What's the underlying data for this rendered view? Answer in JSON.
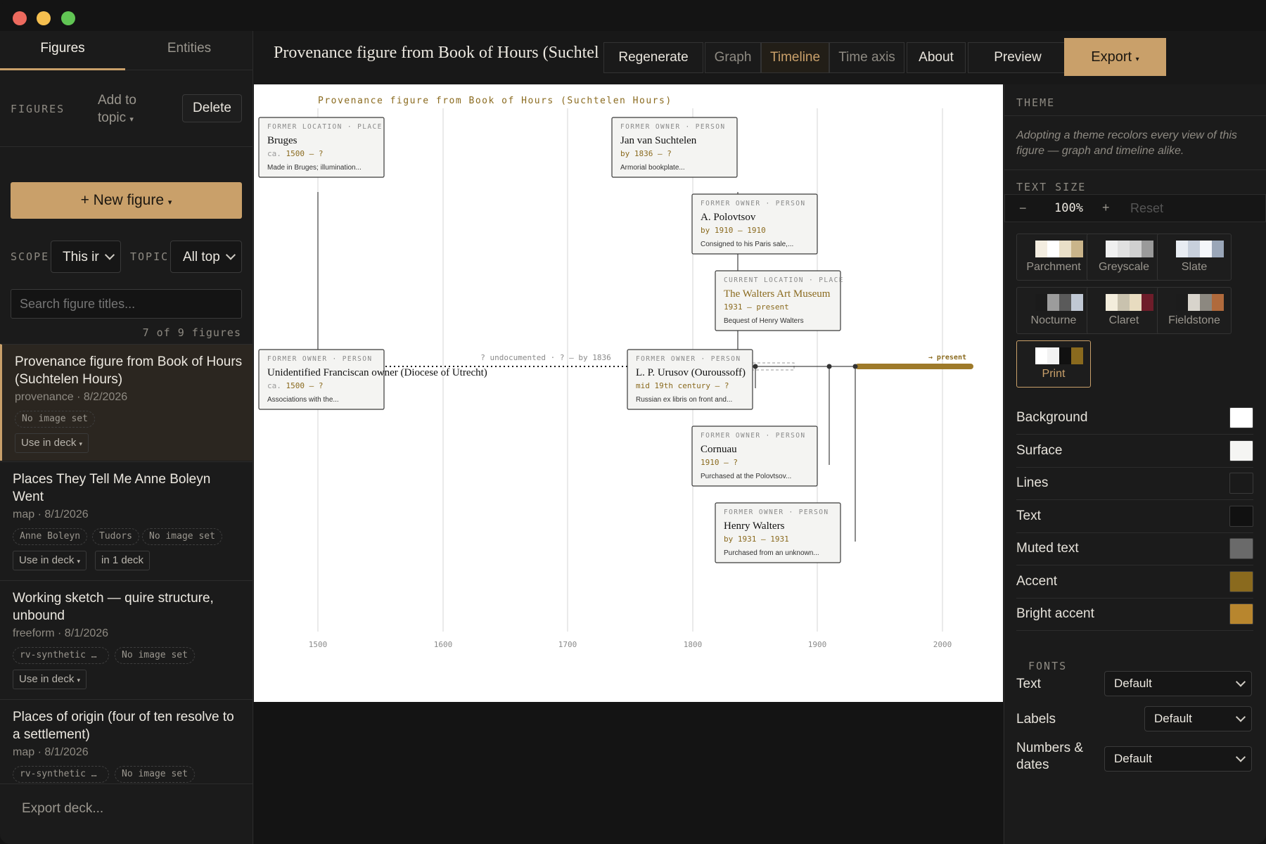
{
  "window": {
    "traffic_colors": [
      "#ed6a5e",
      "#f5bf4f",
      "#61c554"
    ]
  },
  "sidebar": {
    "tabs": [
      "Figures",
      "Entities"
    ],
    "figures_label": "FIGURES",
    "add_to_topic": "Add to topic",
    "delete": "Delete",
    "new_figure": "+ New figure",
    "scope_label": "SCOPE",
    "scope_value": "This ir",
    "topic_label": "TOPIC",
    "topic_value": "All top",
    "search_placeholder": "Search figure titles...",
    "count_text": "7 of 9 figures",
    "items": [
      {
        "title": "Provenance figure from Book of Hours (Suchtelen Hours)",
        "meta": "provenance · 8/2/2026",
        "chips": [
          "No image set"
        ],
        "actions": [
          "Use in deck"
        ]
      },
      {
        "title": "Places They Tell Me Anne Boleyn Went",
        "meta": "map · 8/1/2026",
        "chips": [
          "Anne Boleyn",
          "Tudors",
          "No image set"
        ],
        "actions": [
          "Use in deck",
          "in 1 deck"
        ]
      },
      {
        "title": "Working sketch — quire structure, unbound",
        "meta": "freeform · 8/1/2026",
        "chips": [
          "rv-synthetic …",
          "No image set"
        ],
        "actions": [
          "Use in deck"
        ]
      },
      {
        "title": "Places of origin (four of ten resolve to a settlement)",
        "meta": "map · 8/1/2026",
        "chips": [
          "rv-synthetic …",
          "No image set"
        ],
        "actions": []
      }
    ],
    "export_deck": "Export deck..."
  },
  "toolbar": {
    "title": "Provenance figure from Book of Hours (Suchtel",
    "regenerate": "Regenerate",
    "views": [
      "Graph",
      "Timeline",
      "Time axis"
    ],
    "active_view": "Timeline",
    "about": "About",
    "preview": "Preview",
    "export": "Export"
  },
  "timeline": {
    "title": "Provenance figure from Book of Hours (Suchtelen Hours)",
    "axis_ticks": [
      "1500",
      "1600",
      "1700",
      "1800",
      "1900",
      "2000"
    ],
    "gap_label": "? undocumented · ? — by 1836",
    "present_label": "→ present",
    "cards": [
      {
        "kind": "FORMER LOCATION · PLACE",
        "name": "Bruges",
        "date_prefix": "ca.",
        "date": "1500 – ?",
        "note": "Made in Bruges; illumination..."
      },
      {
        "kind": "FORMER OWNER · PERSON",
        "name": "Jan van Suchtelen",
        "date_prefix": "",
        "date": "by 1836 – ?",
        "note": "Armorial bookplate..."
      },
      {
        "kind": "FORMER OWNER · PERSON",
        "name": "A. Polovtsov",
        "date_prefix": "",
        "date": "by 1910 – 1910",
        "note": "Consigned to his Paris sale,..."
      },
      {
        "kind": "CURRENT LOCATION · PLACE",
        "name": "The Walters Art Museum",
        "date_prefix": "",
        "date": "1931 – present",
        "note": "Bequest of Henry Walters"
      },
      {
        "kind": "FORMER OWNER · PERSON",
        "name": "Unidentified Franciscan owner (Diocese of Utrecht)",
        "date_prefix": "ca.",
        "date": "1500 – ?",
        "note": "Associations with the..."
      },
      {
        "kind": "FORMER OWNER · PERSON",
        "name": "L. P. Urusov (Ouroussoff)",
        "date_prefix": "",
        "date": "mid 19th century – ?",
        "note": "Russian ex libris on front and..."
      },
      {
        "kind": "FORMER OWNER · PERSON",
        "name": "Cornuau",
        "date_prefix": "",
        "date": "1910 – ?",
        "note": "Purchased at the Polovtsov..."
      },
      {
        "kind": "FORMER OWNER · PERSON",
        "name": "Henry Walters",
        "date_prefix": "",
        "date": "by 1931 – 1931",
        "note": "Purchased from an unknown..."
      }
    ]
  },
  "theme_panel": {
    "theme_label": "THEME",
    "description": "Adopting a theme recolors every view of this figure — graph and timeline alike.",
    "text_size_label": "TEXT SIZE",
    "text_size_minus": "−",
    "text_size_value": "100%",
    "text_size_plus": "+",
    "text_size_reset": "Reset",
    "themes": [
      {
        "name": "Parchment",
        "colors": [
          "#f3ede0",
          "#ffffff",
          "#e9dfc8",
          "#c9b48a"
        ]
      },
      {
        "name": "Greyscale",
        "colors": [
          "#f0f0f0",
          "#e0e0e0",
          "#d0d0d0",
          "#9a9a9a"
        ]
      },
      {
        "name": "Slate",
        "colors": [
          "#e8ecf2",
          "#c8d0dc",
          "#f4f6fa",
          "#9aa6b8"
        ]
      },
      {
        "name": "Nocturne",
        "colors": [
          "#1b1b1b",
          "#9c9c9c",
          "#5a5a5a",
          "#c0c8d4"
        ]
      },
      {
        "name": "Claret",
        "colors": [
          "#f3eddc",
          "#c9c2ae",
          "#e8dcc0",
          "#6e1d2a"
        ]
      },
      {
        "name": "Fieldstone",
        "colors": [
          "#1c1c1c",
          "#d8d4cc",
          "#8c8880",
          "#b06a3c"
        ]
      },
      {
        "name": "Print",
        "colors": [
          "#ffffff",
          "#f2f2f2",
          "#111111",
          "#8a6a1e"
        ]
      }
    ],
    "selected_theme": "Print",
    "color_rows": [
      {
        "label": "Background",
        "color": "#ffffff"
      },
      {
        "label": "Surface",
        "color": "#f5f5f3"
      },
      {
        "label": "Lines",
        "color": "#1a1a1a"
      },
      {
        "label": "Text",
        "color": "#111111"
      },
      {
        "label": "Muted text",
        "color": "#6a6a6a"
      },
      {
        "label": "Accent",
        "color": "#8a6a1e"
      },
      {
        "label": "Bright accent",
        "color": "#b8862e"
      }
    ],
    "fonts_label": "FONTS",
    "fonts": [
      {
        "label": "Text",
        "value": "Default"
      },
      {
        "label": "Labels",
        "value": "Default"
      },
      {
        "label": "Numbers & dates",
        "value": "Default"
      }
    ]
  }
}
